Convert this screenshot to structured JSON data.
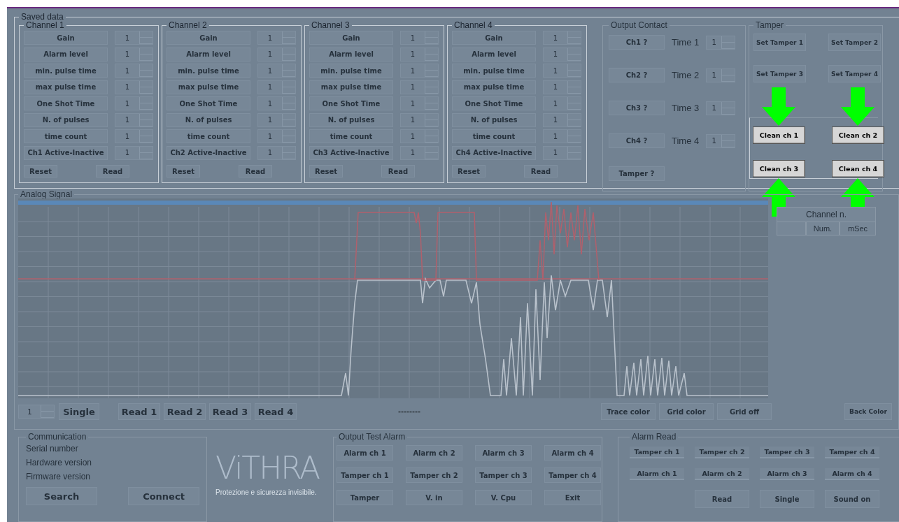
{
  "saved_data": {
    "title": "Saved data",
    "channels": [
      {
        "title": "Channel 1",
        "disabled": true,
        "params": [
          {
            "label": "Gain",
            "value": "1"
          },
          {
            "label": "Alarm level",
            "value": "1"
          },
          {
            "label": "min. pulse time",
            "value": "1"
          },
          {
            "label": "max pulse time",
            "value": "1"
          },
          {
            "label": "One Shot Time",
            "value": "1"
          },
          {
            "label": "N. of pulses",
            "value": "1"
          },
          {
            "label": "time count",
            "value": "1"
          },
          {
            "label": "Ch1 Active-Inactive",
            "value": "1"
          }
        ],
        "buttons": [
          "Reset",
          "Read"
        ]
      },
      {
        "title": "Channel 2",
        "disabled": true,
        "params": [
          {
            "label": "Gain",
            "value": "1"
          },
          {
            "label": "Alarm level",
            "value": "1"
          },
          {
            "label": "min. pulse time",
            "value": "1"
          },
          {
            "label": "max pulse time",
            "value": "1"
          },
          {
            "label": "One Shot Time",
            "value": "1"
          },
          {
            "label": "N. of pulses",
            "value": "1"
          },
          {
            "label": "time count",
            "value": "1"
          },
          {
            "label": "Ch2 Active-Inactive",
            "value": "1"
          }
        ],
        "buttons": [
          "Reset",
          "Read"
        ]
      },
      {
        "title": "Channel 3",
        "disabled": true,
        "params": [
          {
            "label": "Gain",
            "value": "1"
          },
          {
            "label": "Alarm level",
            "value": "1"
          },
          {
            "label": "min. pulse time",
            "value": "1"
          },
          {
            "label": "max pulse time",
            "value": "1"
          },
          {
            "label": "One Shot Time",
            "value": "1"
          },
          {
            "label": "N. of pulses",
            "value": "1"
          },
          {
            "label": "time count",
            "value": "1"
          },
          {
            "label": "Ch3 Active-Inactive",
            "value": "1"
          }
        ],
        "buttons": [
          "Reset",
          "Read"
        ]
      },
      {
        "title": "Channel 4",
        "disabled": true,
        "params": [
          {
            "label": "Gain",
            "value": "1"
          },
          {
            "label": "Alarm level",
            "value": "1"
          },
          {
            "label": "min. pulse time",
            "value": "1"
          },
          {
            "label": "max pulse time",
            "value": "1"
          },
          {
            "label": "One Shot Time",
            "value": "1"
          },
          {
            "label": "N. of pulses",
            "value": "1"
          },
          {
            "label": "time count",
            "value": "1"
          },
          {
            "label": "Ch4 Active-Inactive",
            "value": "1"
          }
        ],
        "buttons": [
          "Reset",
          "Read"
        ]
      }
    ],
    "output_contact": {
      "title": "Output Contact",
      "disabled": true,
      "rows": [
        {
          "button": "Ch1 ?",
          "label": "Time 1",
          "value": "1"
        },
        {
          "button": "Ch2 ?",
          "label": "Time 2",
          "value": "1"
        },
        {
          "button": "Ch3 ?",
          "label": "Time 3",
          "value": "1"
        },
        {
          "button": "Ch4 ?",
          "label": "Time 4",
          "value": "1"
        }
      ],
      "button": "Tamper ?"
    },
    "tamper": {
      "title": "Tamper",
      "disabled": true,
      "buttons": [
        "Set Tamper 1",
        "Set Tamper 2",
        "Set Tamper 3",
        "Set Tamper 4"
      ]
    },
    "clean": {
      "disabled": false,
      "buttons": [
        "Clean ch 1",
        "Clean ch 2",
        "Clean ch 3",
        "Clean ch 4"
      ]
    }
  },
  "analog_signal": {
    "title": "Analog Signal",
    "disabled": true,
    "table": {
      "title": "Channel n.",
      "columns": [
        "Num.",
        "mSec"
      ]
    },
    "spinner": "1",
    "buttons": [
      "Single",
      "Read 1",
      "Read 2",
      "Read 3",
      "Read 4"
    ],
    "status": "--------",
    "color_buttons": [
      "Trace color",
      "Grid color",
      "Grid off"
    ],
    "back_button": "Back Color"
  },
  "communication": {
    "title": "Communication",
    "disabled": true,
    "labels": [
      "Serial number",
      "Hardware version",
      "Firmware version"
    ],
    "buttons": [
      "Search",
      "Connect"
    ]
  },
  "logo": {
    "name": "ViTHRA",
    "tagline": "Protezione e sicurezza invisibile."
  },
  "output_test_alarm": {
    "title": "Output Test Alarm",
    "disabled": true,
    "buttons": [
      "Alarm ch 1",
      "Alarm ch 2",
      "Alarm ch 3",
      "Alarm ch 4",
      "Tamper ch 1",
      "Tamper ch 2",
      "Tamper ch 3",
      "Tamper ch 4",
      "Tamper",
      "V. in",
      "V. Cpu",
      "Exit"
    ]
  },
  "alarm_read": {
    "title": "Alarm Read",
    "disabled": true,
    "indicators": [
      "Tamper ch 1",
      "Tamper ch 2",
      "Tamper ch 3",
      "Tamper ch 4",
      "Alarm ch 1",
      "Alarm ch 2",
      "Alarm ch 3",
      "Alarm ch 4"
    ],
    "buttons": [
      "Read",
      "Single",
      "Sound on"
    ]
  }
}
